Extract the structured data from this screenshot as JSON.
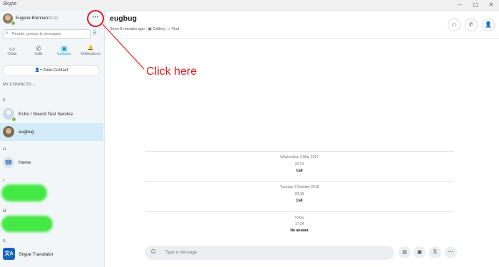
{
  "window": {
    "app_name": "Skype",
    "min": "–",
    "max": "▢",
    "close": "✕"
  },
  "profile": {
    "name": "Eugene Brennan",
    "credit": "€0,00",
    "more_label": "···"
  },
  "search": {
    "placeholder": "People, groups & messages"
  },
  "nav": [
    {
      "label": "Chats",
      "icon": "chat-icon",
      "glyph": "▭"
    },
    {
      "label": "Calls",
      "icon": "phone-icon",
      "glyph": "✆"
    },
    {
      "label": "Contacts",
      "icon": "contacts-icon",
      "glyph": "▣"
    },
    {
      "label": "Notifications",
      "icon": "bell-icon",
      "glyph": "🔔"
    }
  ],
  "new_contact": {
    "label": "New Contact"
  },
  "contacts_header": "MY CONTACTS",
  "contacts": {
    "groups": [
      {
        "letter": "E",
        "items": [
          {
            "name": "Echo / Sound Test Service"
          },
          {
            "name": "eugbug"
          }
        ]
      },
      {
        "letter": "H",
        "items": [
          {
            "name": "Home"
          }
        ]
      },
      {
        "letter": "I"
      },
      {
        "letter": "M"
      },
      {
        "letter": "S",
        "items": [
          {
            "name": "Skype Translator"
          }
        ]
      }
    ]
  },
  "chat": {
    "title": "eugbug",
    "seen": "Seen 8 minutes ago",
    "gallery": "Gallery",
    "find": "Find"
  },
  "conversation": [
    {
      "date": "Wednesday 3 May 2017",
      "time": "20:23",
      "event": "Call"
    },
    {
      "date": "Tuesday 2 October 2018",
      "time": "00:39",
      "event": "Call"
    },
    {
      "date": "Today",
      "time": "17:24",
      "event": "No answer"
    }
  ],
  "composer": {
    "placeholder": "Type a message"
  },
  "annotation": {
    "text": "Click here"
  },
  "colors": {
    "accent": "#00a2d8",
    "annotation": "#e21b1b",
    "selected_row": "#d4ecfa"
  }
}
